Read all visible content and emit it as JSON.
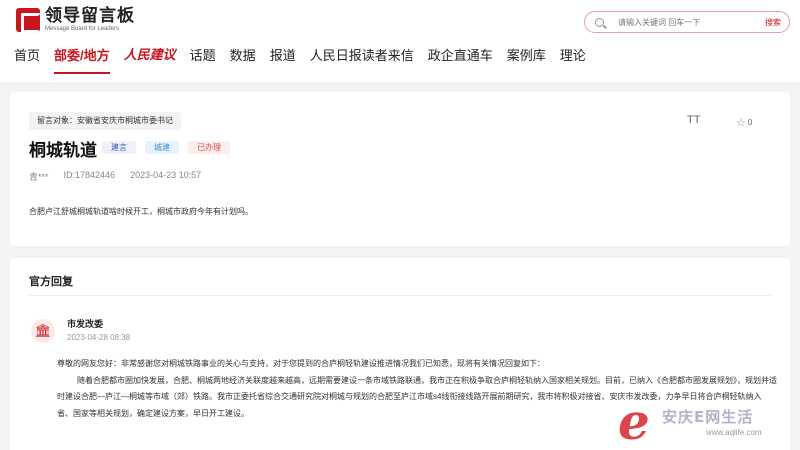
{
  "header": {
    "logo_cn": "领导留言板",
    "logo_en": "Message Board for Leaders",
    "search_placeholder": "请输入关键词 回车一下",
    "search_button": "搜索"
  },
  "nav": [
    {
      "label": "首页",
      "active": false
    },
    {
      "label": "部委/地方",
      "active": true
    },
    {
      "label": "人民建议",
      "active": false,
      "brand": true
    },
    {
      "label": "话题",
      "active": false
    },
    {
      "label": "数据",
      "active": false
    },
    {
      "label": "报道",
      "active": false
    },
    {
      "label": "人民日报读者来信",
      "active": false
    },
    {
      "label": "政企直通车",
      "active": false
    },
    {
      "label": "案例库",
      "active": false
    },
    {
      "label": "理论",
      "active": false
    }
  ],
  "message": {
    "target": "留言对象：安徽省安庆市桐城市委书记",
    "title": "桐城轨道",
    "tags": [
      "建言",
      "城建",
      "已办理"
    ],
    "author": "青***",
    "id": "ID:17842446",
    "time": "2023-04-23 10:57",
    "content": "合肥卢江舒城桐城轨道啥时候开工，桐城市政府今年有计划吗。",
    "font_button": "TT",
    "star_count": "0"
  },
  "reply": {
    "section_title": "官方回复",
    "dept": "市发改委",
    "time": "2023-04-28 08:38",
    "greeting": "尊敬的网友您好：非常感谢您对桐城铁路事业的关心与支持，对于您提到的合庐桐轻轨建设推进情况我们已知悉，现将有关情况回复如下：",
    "body": "随着合肥都市圈加快发展，合肥、桐城两地经济关联度越来越高，远期需要建设一条市域铁路联通，我市正在积极争取合庐桐轻轨纳入国家相关规划。目前，已纳入《合肥都市圈发展规划》，规划并适时建设合肥—庐江—桐城等市域（郊）铁路。我市正委托省综合交通研究院对桐城与规划的合肥至庐江市域s4线衔接线路开展前期研究，我市将积极对接省、安庆市发改委，力争早日将合庐桐轻轨纳入省、国家等相关规划，确定建设方案，早日开工建设。"
  },
  "watermark": {
    "letter": "e",
    "name": "安庆E网生活",
    "url": "www.aqlife.com"
  },
  "colors": {
    "brand_red": "#c8161e",
    "background": "#f2f3f5"
  }
}
